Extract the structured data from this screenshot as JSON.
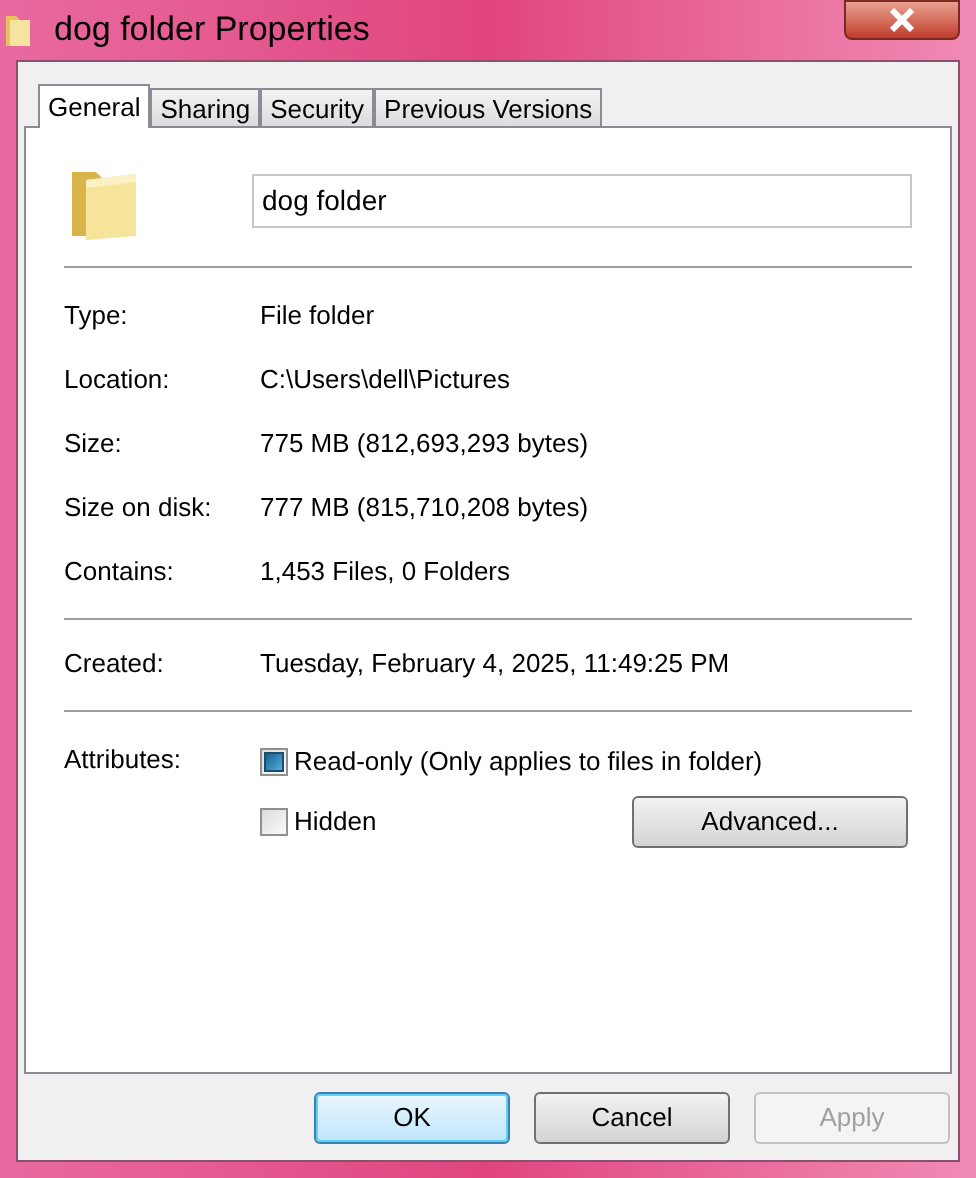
{
  "window": {
    "title": "dog folder Properties"
  },
  "tabs": [
    {
      "label": "General",
      "selected": true
    },
    {
      "label": "Sharing",
      "selected": false
    },
    {
      "label": "Security",
      "selected": false
    },
    {
      "label": "Previous Versions",
      "selected": false
    }
  ],
  "name_field": {
    "value": "dog folder"
  },
  "details": [
    {
      "label": "Type:",
      "value": "File folder"
    },
    {
      "label": "Location:",
      "value": "C:\\Users\\dell\\Pictures"
    },
    {
      "label": "Size:",
      "value": "775 MB (812,693,293 bytes)"
    },
    {
      "label": "Size on disk:",
      "value": "777 MB (815,710,208 bytes)"
    },
    {
      "label": "Contains:",
      "value": "1,453 Files, 0 Folders"
    }
  ],
  "created": {
    "label": "Created:",
    "value": "Tuesday, February 4, 2025, 11:49:25 PM"
  },
  "attributes": {
    "label": "Attributes:",
    "options": [
      {
        "label": "Read-only (Only applies to files in folder)",
        "mixed": true
      },
      {
        "label": "Hidden",
        "mixed": false
      }
    ],
    "advanced_button": "Advanced..."
  },
  "buttons": [
    {
      "label": "OK",
      "default": true,
      "disabled": false
    },
    {
      "label": "Cancel",
      "default": false,
      "disabled": false
    },
    {
      "label": "Apply",
      "default": false,
      "disabled": true
    }
  ]
}
